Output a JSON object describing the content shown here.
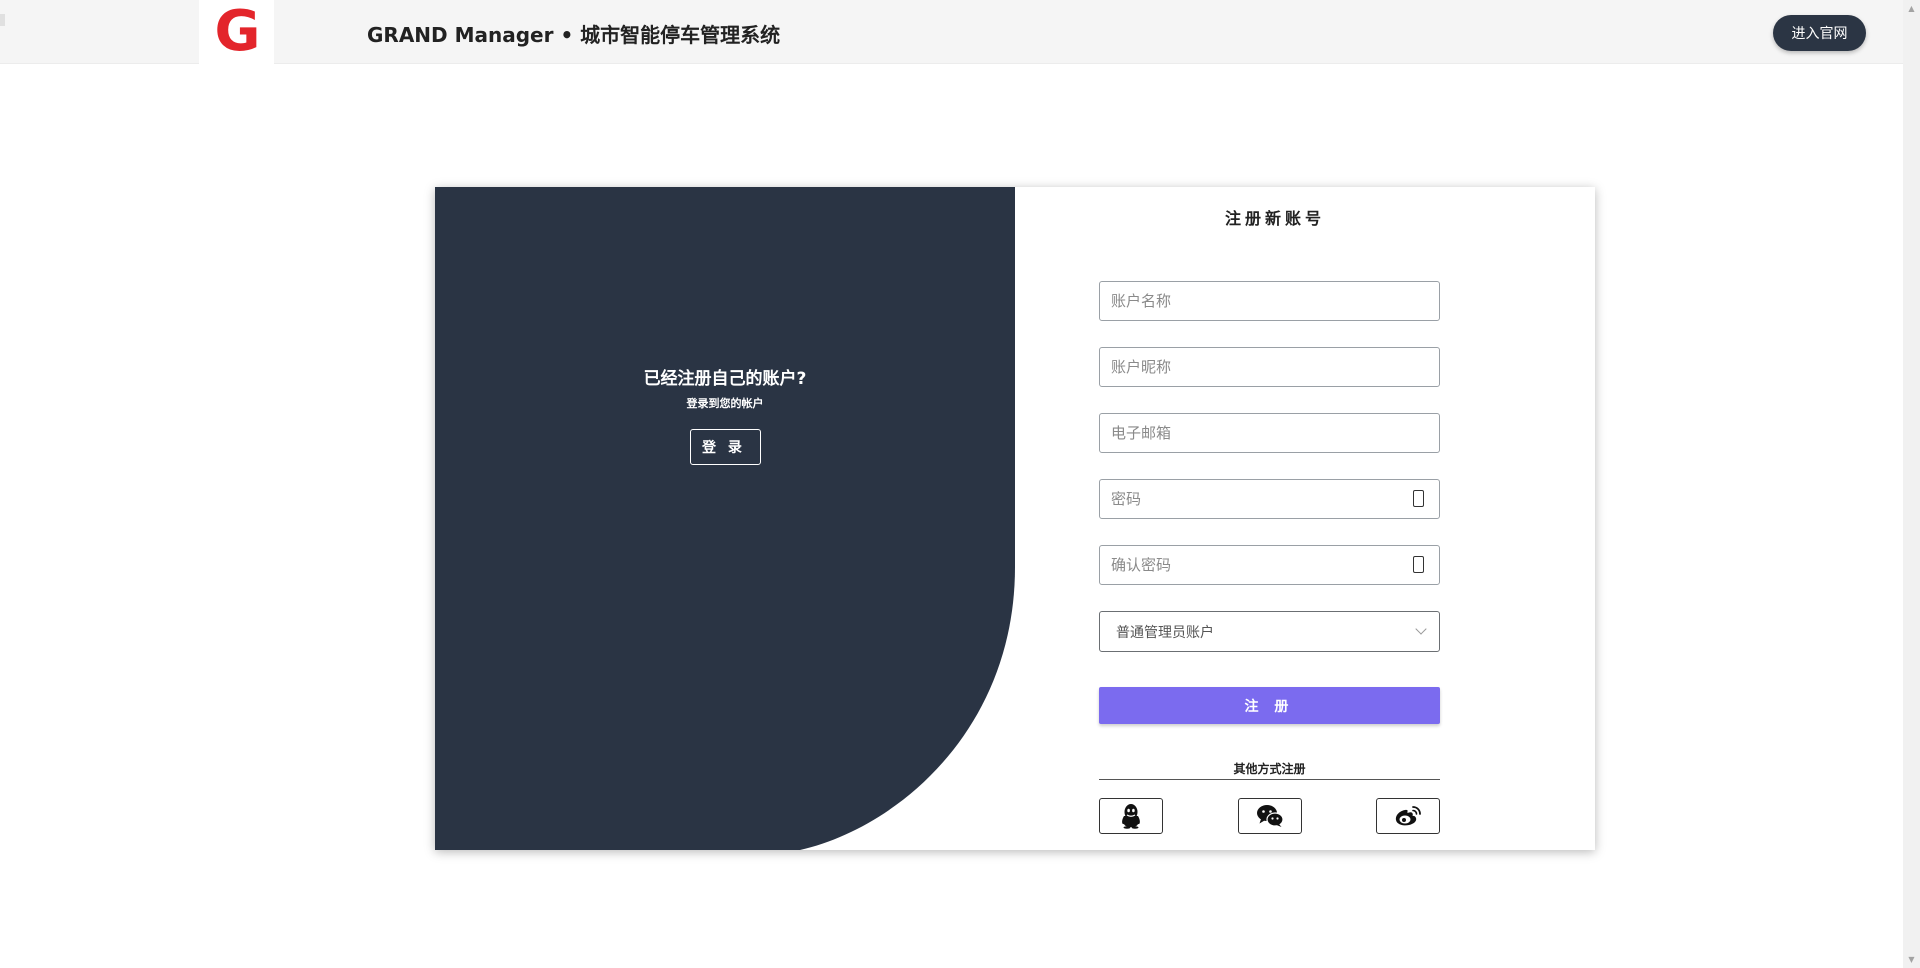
{
  "header": {
    "logo_letter": "G",
    "app_title": "GRAND Manager • 城市智能停车管理系统",
    "official_site_label": "进入官网"
  },
  "left_panel": {
    "heading": "已经注册自己的账户?",
    "subheading": "登录到您的帐户",
    "login_button_label": "登 录"
  },
  "form": {
    "title": "注册新账号",
    "account_name_placeholder": "账户名称",
    "nickname_placeholder": "账户昵称",
    "email_placeholder": "电子邮箱",
    "password_placeholder": "密码",
    "confirm_password_placeholder": "确认密码",
    "account_type_selected": "普通管理员账户",
    "submit_label": "注 册",
    "other_methods_label": "其他方式注册",
    "social_icons": [
      "qq-icon",
      "wechat-icon",
      "weibo-icon"
    ]
  },
  "colors": {
    "dark_panel": "#2a3444",
    "accent": "#7b6bef",
    "logo_red": "#e3252b"
  }
}
